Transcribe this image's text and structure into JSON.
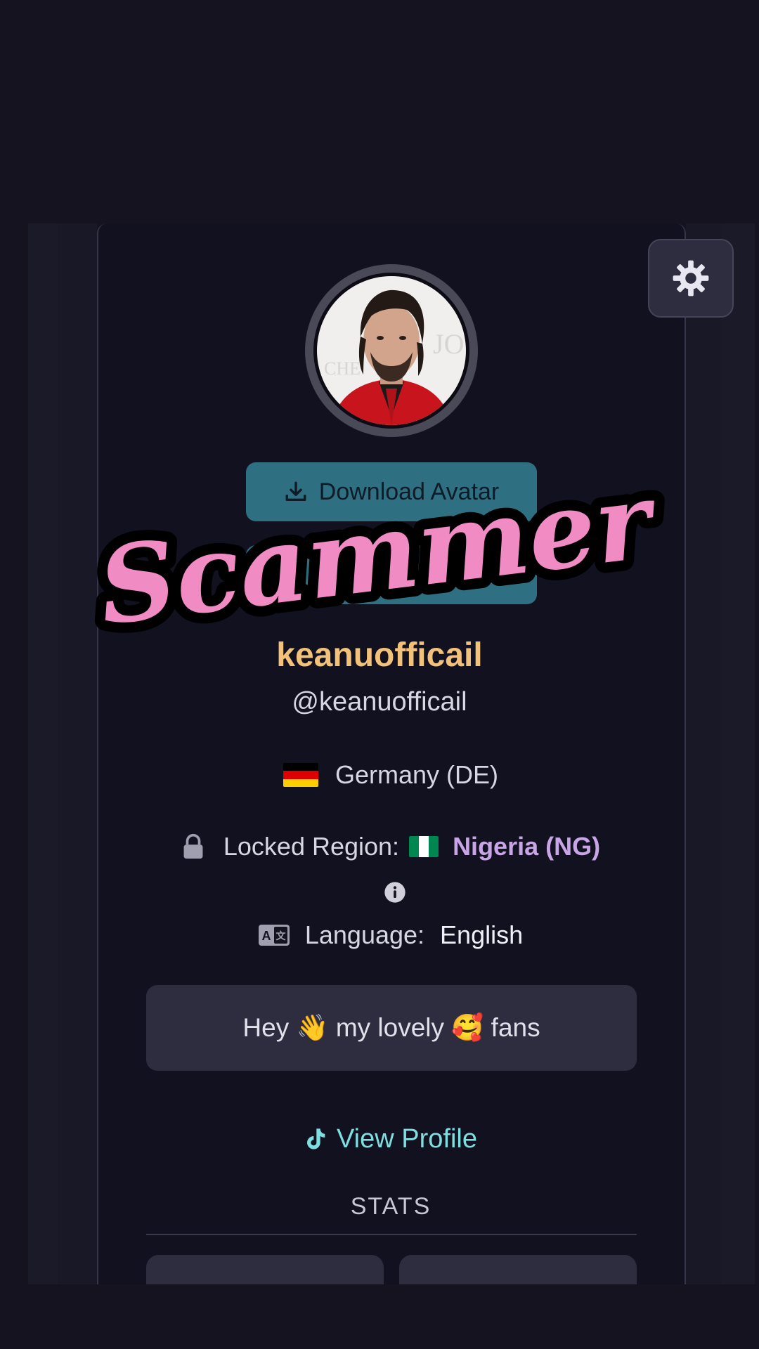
{
  "overlay": {
    "text": "Scammer",
    "color": "#f08bc4"
  },
  "profile": {
    "display_name": "keanuofficail",
    "handle": "@keanuofficail",
    "country": "Germany (DE)",
    "locked_region_label": "Locked Region:",
    "locked_region_value": "Nigeria (NG)",
    "language_label": "Language:",
    "language_value": "English",
    "bio": "Hey 👋 my lovely 🥰 fans"
  },
  "buttons": {
    "download_avatar": "Download Avatar",
    "view_profile": "View Profile"
  },
  "stats": {
    "title": "STATS"
  },
  "icons": {
    "settings": "gear-icon",
    "download": "download-icon",
    "lock": "lock-icon",
    "info": "info-icon",
    "language": "translate-icon",
    "tiktok": "tiktok-icon"
  },
  "colors": {
    "background": "#14131f",
    "accent_teal": "#2e7082",
    "name_gold": "#f2c27a",
    "region_purple": "#c8a5e6",
    "link_cyan": "#7fdfe0"
  }
}
